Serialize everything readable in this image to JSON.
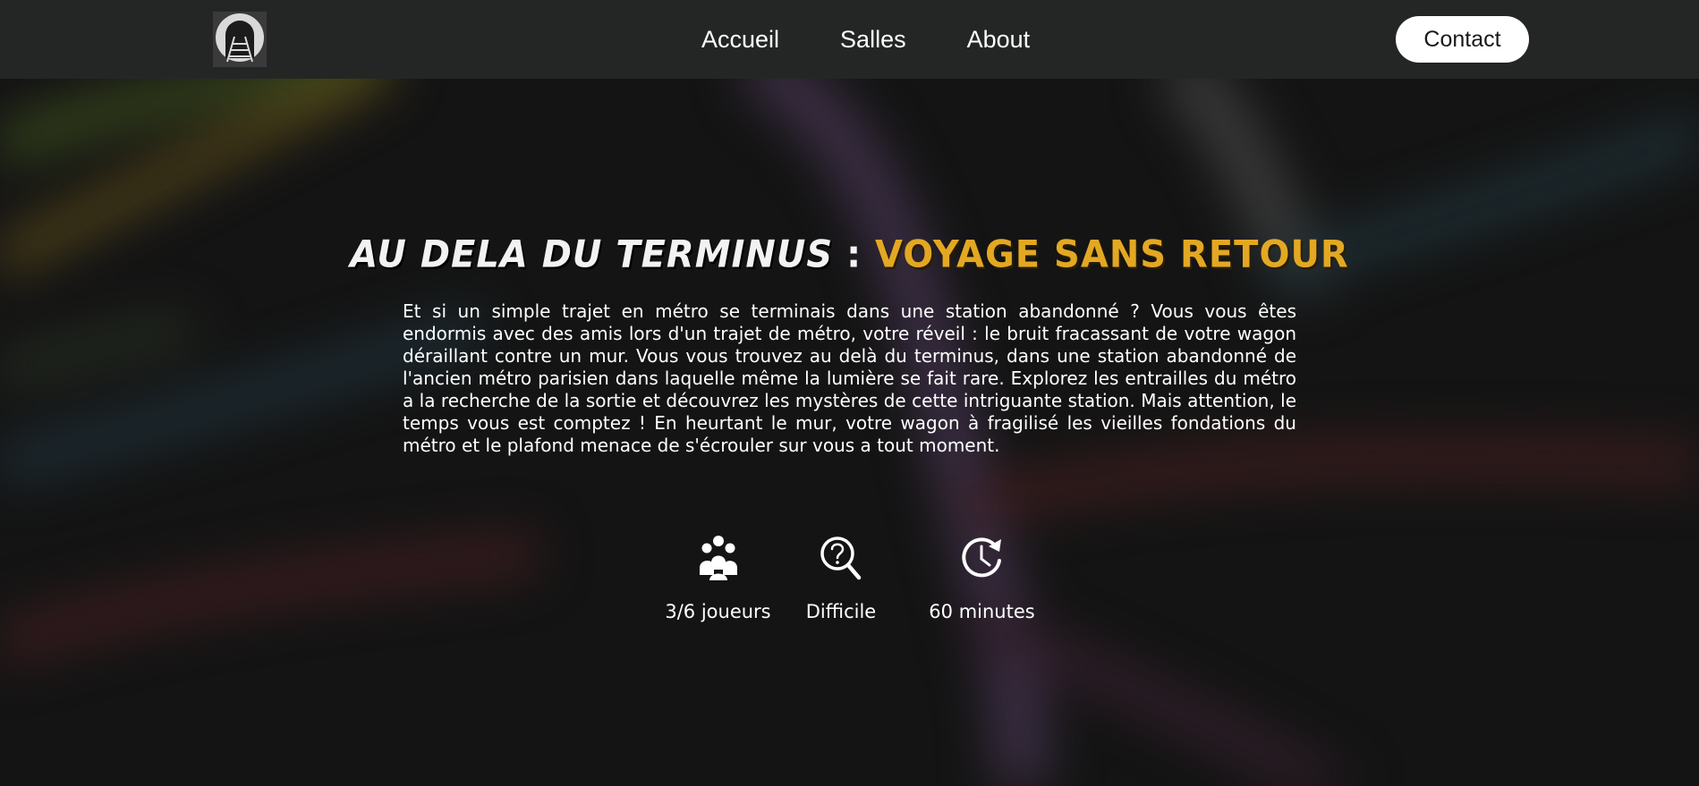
{
  "header": {
    "logo_icon": "metro-tunnel-logo-icon",
    "nav": [
      {
        "label": "Accueil"
      },
      {
        "label": "Salles"
      },
      {
        "label": "About"
      }
    ],
    "contact_label": "Contact"
  },
  "hero": {
    "title_part1": "AU DELA DU TERMINUS",
    "title_separator": " : ",
    "title_part2": "VOYAGE SANS RETOUR",
    "description": "Et si un simple trajet en métro se terminais dans une station abandonné ? Vous vous êtes endormis avec des amis lors d'un trajet de métro, votre réveil : le bruit fracassant de votre wagon déraillant contre un mur. Vous vous trouvez au delà du terminus, dans une station abandonné de l'ancien métro parisien dans laquelle même la lumière se fait rare. Explorez les entrailles du métro a la recherche de la sortie et découvrez les mystères de cette intriguante station. Mais attention, le temps vous est comptez ! En heurtant le mur, votre wagon à fragilisé les vieilles fondations du métro et le plafond menace de s'écrouler sur vous a tout moment."
  },
  "stats": [
    {
      "icon": "group-icon",
      "label": "3/6 joueurs"
    },
    {
      "icon": "magnifier-question-icon",
      "label": "Difficile"
    },
    {
      "icon": "clock-refresh-icon",
      "label": "60 minutes"
    }
  ],
  "colors": {
    "navbar": "#242626",
    "background": "#141414",
    "title_accent": "#e3a823",
    "text": "#ffffff"
  }
}
